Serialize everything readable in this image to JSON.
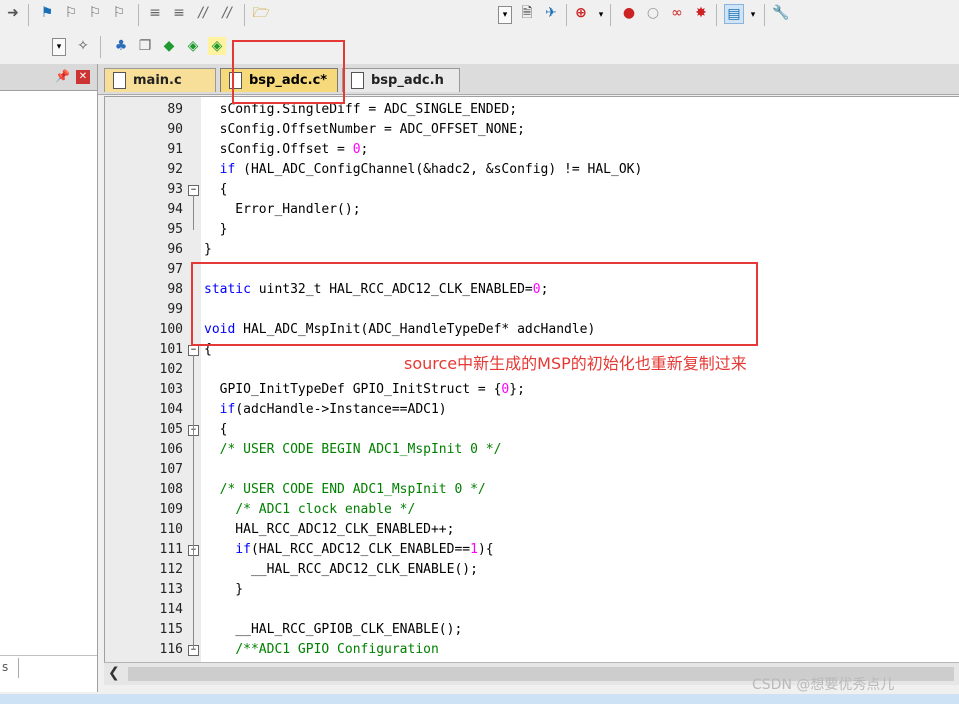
{
  "toolbar1": {
    "icons": [
      "forward-arrow-icon",
      "bookmark-flag-icon",
      "prev-bookmark-icon",
      "next-bookmark-icon",
      "clear-bookmarks-icon",
      "indent-icon",
      "unindent-icon",
      "comment-icon",
      "uncomment-icon",
      "open-folder-icon",
      "find-in-files-icon",
      "incremental-find-icon",
      "debug-session-icon",
      "breakpoint-icon",
      "disable-breakpoint-icon",
      "kill-breakpoints-icon",
      "config-icon",
      "wrench-icon"
    ]
  },
  "toolbar2": {
    "icons": [
      "magic-wand-icon",
      "manage-project-icon",
      "copy-icon",
      "diamond-icon",
      "pack-installer-icon",
      "rte-icon"
    ]
  },
  "left_pane": {
    "pin_glyph": "📌",
    "close_glyph": "✕",
    "bottom_text": "s"
  },
  "tabs": [
    {
      "label": "main.c",
      "active": false
    },
    {
      "label": "bsp_adc.c*",
      "active": true
    },
    {
      "label": "bsp_adc.h",
      "active": false
    }
  ],
  "code_lines": [
    {
      "n": "89",
      "html": "  sConfig.SingleDiff = ADC_SINGLE_ENDED;"
    },
    {
      "n": "90",
      "html": "  sConfig.OffsetNumber = ADC_OFFSET_NONE;"
    },
    {
      "n": "91",
      "html": "  sConfig.Offset = <span class='num'>0</span>;"
    },
    {
      "n": "92",
      "html": "  <span class='kw'>if</span> (HAL_ADC_ConfigChannel(&amp;hadc2, &amp;sConfig) != HAL_OK)"
    },
    {
      "n": "93",
      "html": "  {"
    },
    {
      "n": "94",
      "html": "    Error_Handler();"
    },
    {
      "n": "95",
      "html": "  }"
    },
    {
      "n": "96",
      "html": "}"
    },
    {
      "n": "97",
      "html": ""
    },
    {
      "n": "98",
      "html": "<span class='kw'>static</span> uint32_t HAL_RCC_ADC12_CLK_ENABLED=<span class='num'>0</span>;"
    },
    {
      "n": "99",
      "html": ""
    },
    {
      "n": "100",
      "html": "<span class='kw'>void</span> HAL_ADC_MspInit(ADC_HandleTypeDef* adcHandle)"
    },
    {
      "n": "101",
      "html": "{"
    },
    {
      "n": "102",
      "html": ""
    },
    {
      "n": "103",
      "html": "  GPIO_InitTypeDef GPIO_InitStruct = {<span class='num'>0</span>};"
    },
    {
      "n": "104",
      "html": "  <span class='kw'>if</span>(adcHandle-&gt;Instance==ADC1)"
    },
    {
      "n": "105",
      "html": "  {"
    },
    {
      "n": "106",
      "html": "  <span class='cm'>/* USER CODE BEGIN ADC1_MspInit 0 */</span>"
    },
    {
      "n": "107",
      "html": ""
    },
    {
      "n": "108",
      "html": "  <span class='cm'>/* USER CODE END ADC1_MspInit 0 */</span>"
    },
    {
      "n": "109",
      "html": "    <span class='cm'>/* ADC1 clock enable */</span>"
    },
    {
      "n": "110",
      "html": "    HAL_RCC_ADC12_CLK_ENABLED++;"
    },
    {
      "n": "111",
      "html": "    <span class='kw'>if</span>(HAL_RCC_ADC12_CLK_ENABLED==<span class='num'>1</span>){"
    },
    {
      "n": "112",
      "html": "      __HAL_RCC_ADC12_CLK_ENABLE();"
    },
    {
      "n": "113",
      "html": "    }"
    },
    {
      "n": "114",
      "html": ""
    },
    {
      "n": "115",
      "html": "    __HAL_RCC_GPIOB_CLK_ENABLE();"
    },
    {
      "n": "116",
      "html": "    <span class='cm'>/**ADC1 GPIO Configuration</span>"
    }
  ],
  "fold_markers": [
    "93",
    "101",
    "105",
    "111",
    "116"
  ],
  "annotation": "source中新生成的MSP的初始化也重新复制过来",
  "watermark": "CSDN @想要优秀点儿",
  "colors": {
    "keyword": "#0000ff",
    "number": "#ff00ff",
    "comment": "#008000",
    "highlight_box": "#e53935",
    "active_tab": "#f5d97a"
  }
}
